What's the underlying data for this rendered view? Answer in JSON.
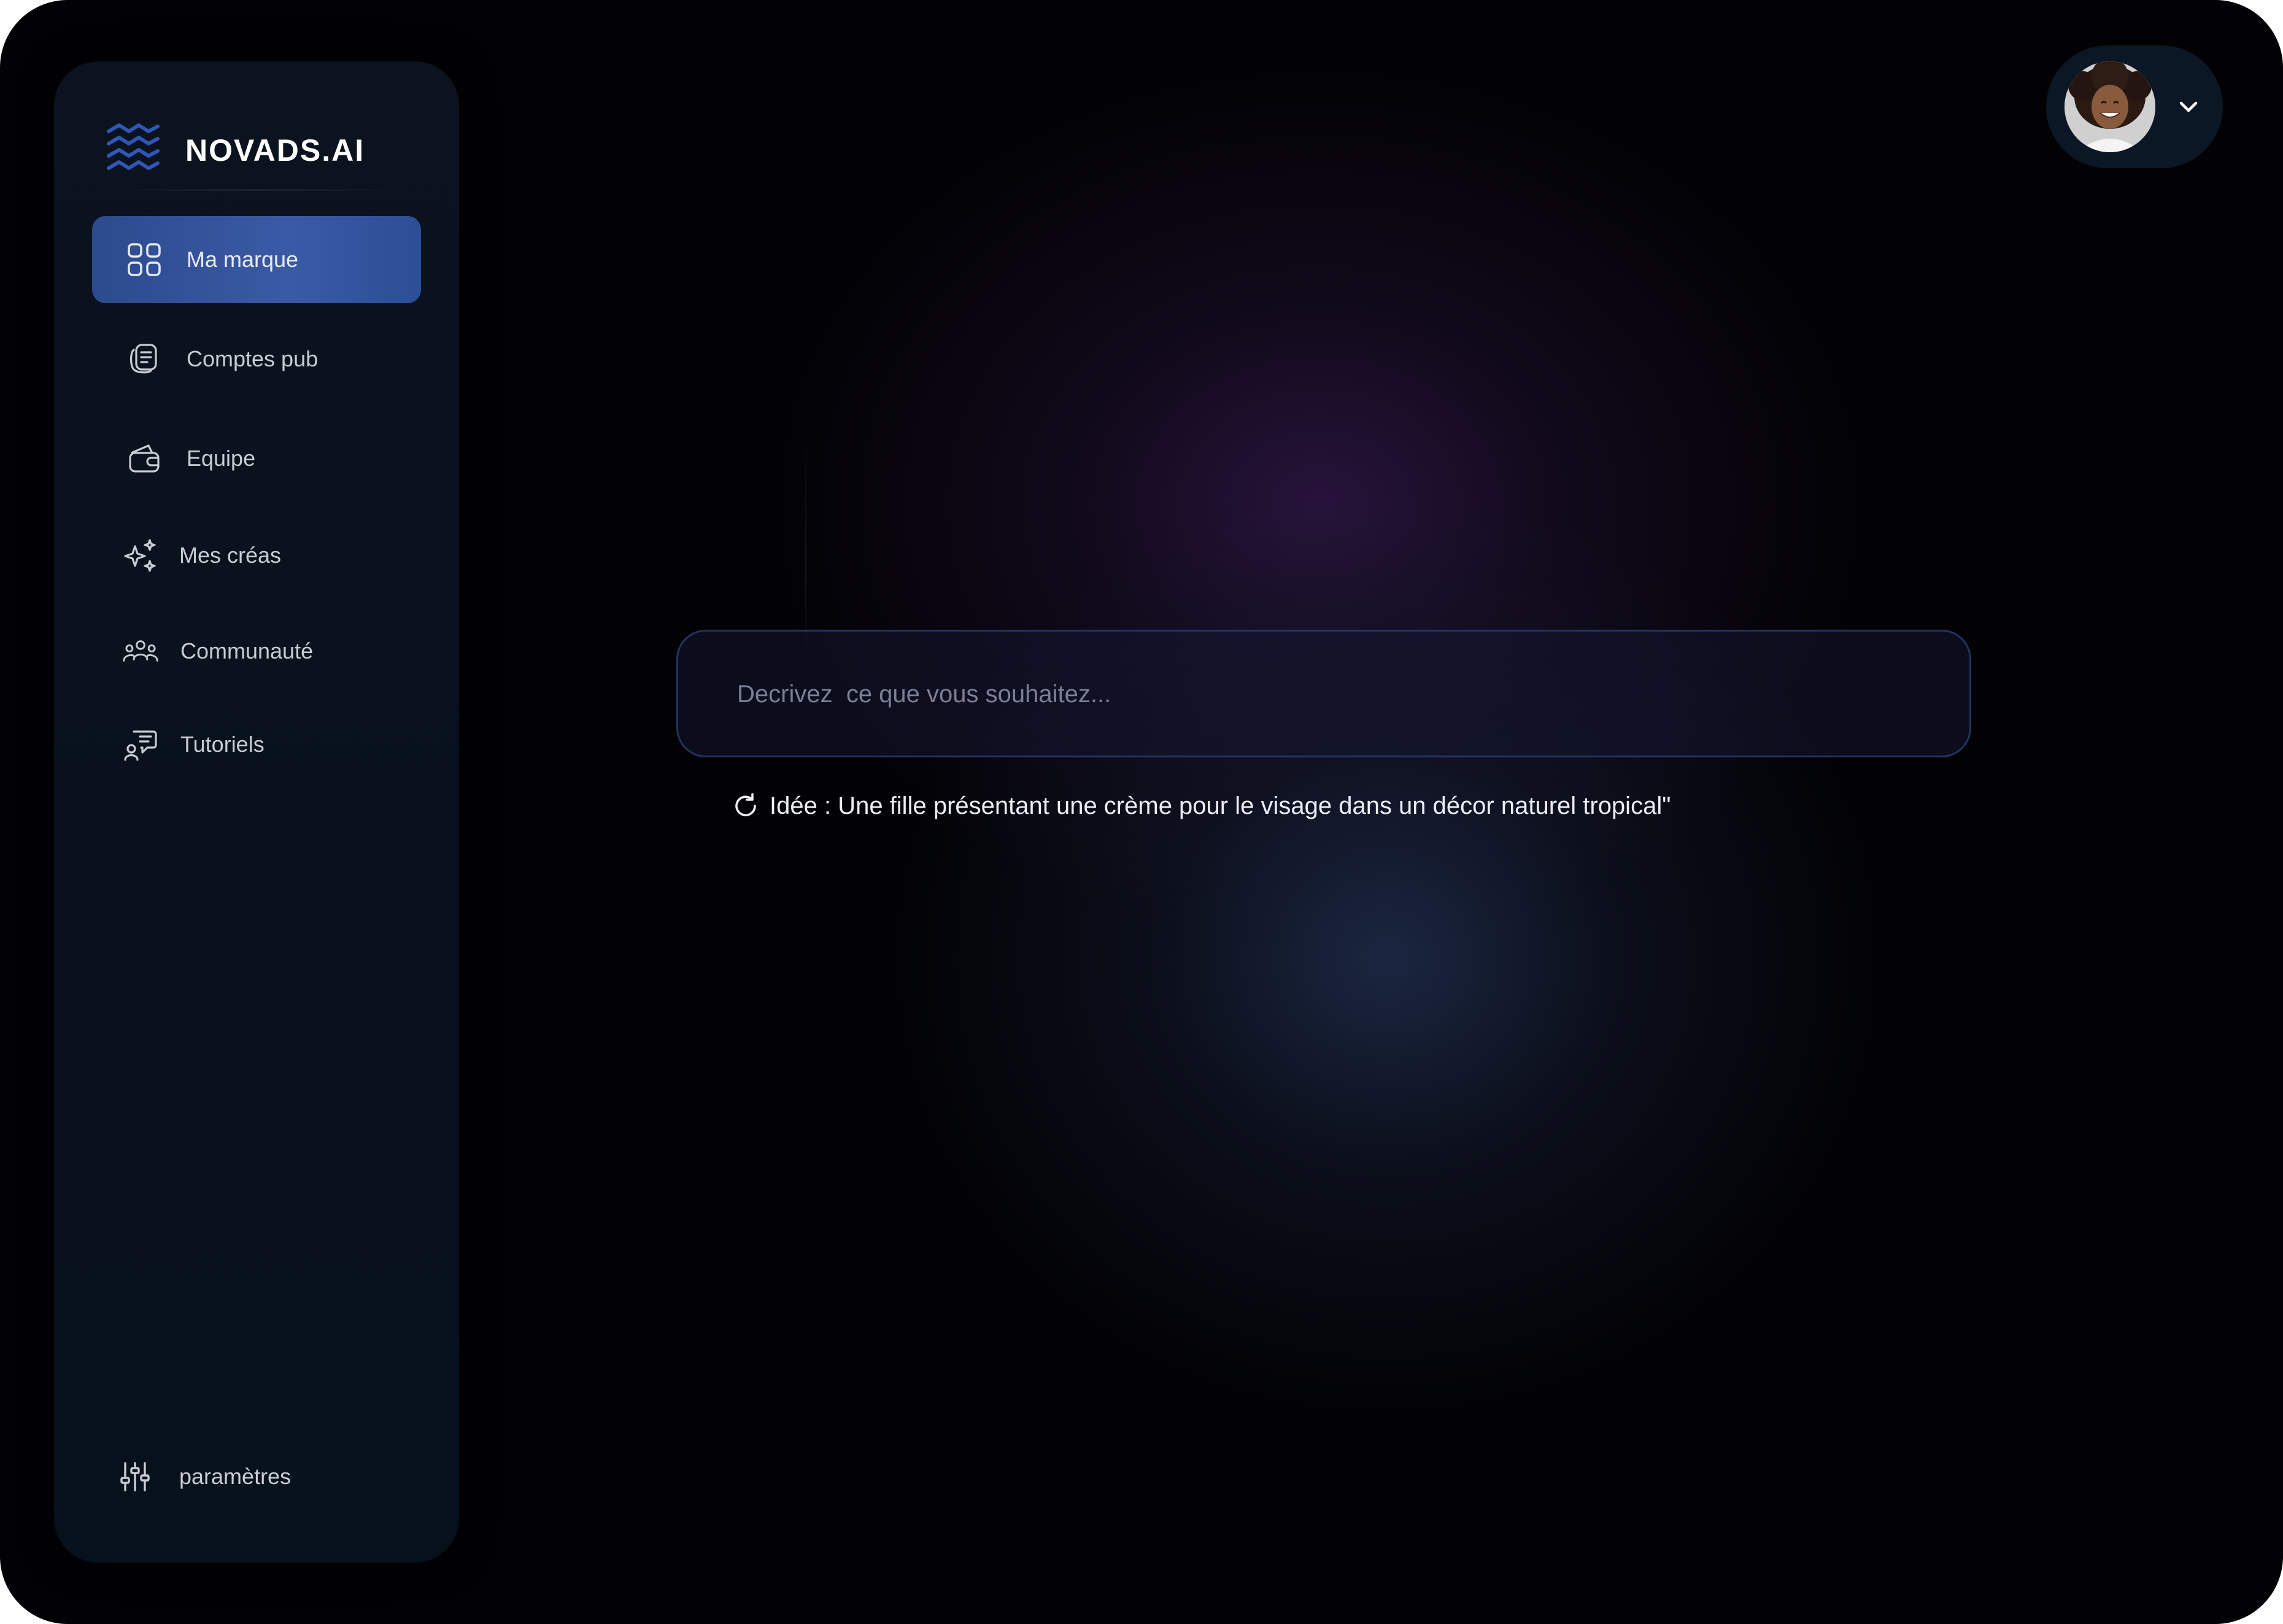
{
  "app": {
    "brand": "NOVADS.AI",
    "accent_color": "#3a5aa6"
  },
  "sidebar": {
    "items": [
      {
        "label": "Ma marque",
        "icon": "grid-icon",
        "active": true
      },
      {
        "label": "Comptes pub",
        "icon": "document-stack-icon",
        "active": false
      },
      {
        "label": "Equipe",
        "icon": "wallet-icon",
        "active": false
      },
      {
        "label": "Mes créas",
        "icon": "sparkles-icon",
        "active": false
      },
      {
        "label": "Communauté",
        "icon": "people-icon",
        "active": false
      },
      {
        "label": "Tutoriels",
        "icon": "chat-person-icon",
        "active": false
      }
    ],
    "settings_label": "paramètres"
  },
  "header": {
    "avatar_icon": "user-avatar",
    "menu_icon": "chevron-down-icon"
  },
  "prompt": {
    "placeholder": "Decrivez  ce que vous souhaitez...",
    "value": ""
  },
  "idea": {
    "text": "Idée : Une fille présentant une crème pour le visage dans un décor naturel tropical\"",
    "icon": "refresh-icon"
  }
}
